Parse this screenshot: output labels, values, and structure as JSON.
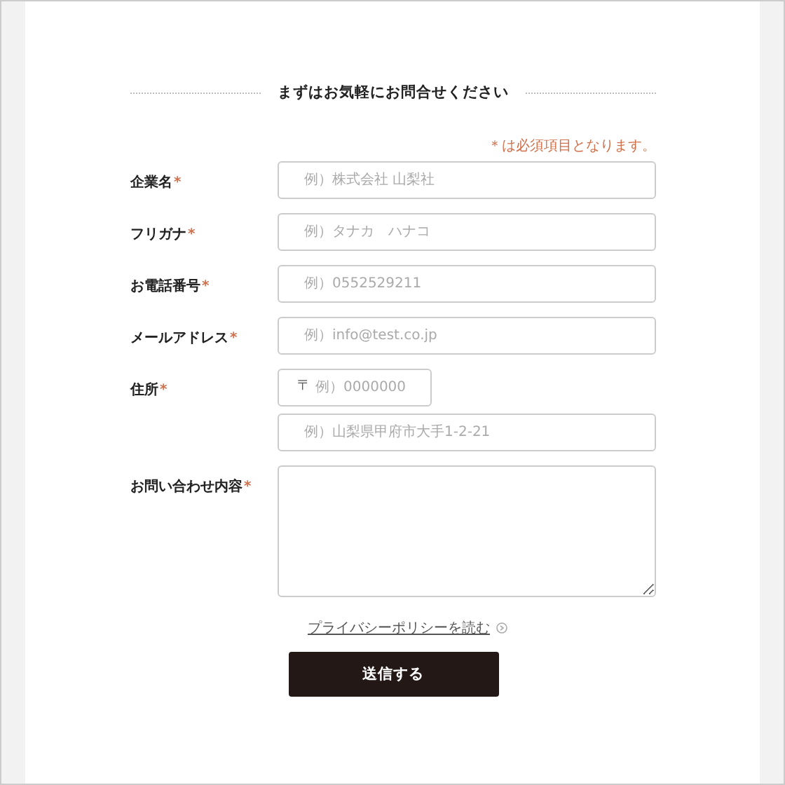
{
  "heading": "まずはお気軽にお問合せください",
  "required_note": "＊は必須項目となります。",
  "fields": [
    {
      "label": "企業名",
      "mark": "*",
      "kind": "text",
      "inputs": [
        {
          "placeholder": "例）株式会社 山梨社"
        }
      ]
    },
    {
      "label": "フリガナ",
      "mark": "*",
      "kind": "text",
      "inputs": [
        {
          "placeholder": "例）タナカ　ハナコ"
        }
      ]
    },
    {
      "label": "お電話番号",
      "mark": "*",
      "kind": "text",
      "inputs": [
        {
          "placeholder": "例）0552529211"
        }
      ]
    },
    {
      "label": "メールアドレス",
      "mark": "*",
      "kind": "text",
      "inputs": [
        {
          "placeholder": "例）info@test.co.jp"
        }
      ]
    },
    {
      "label": "住所",
      "mark": "*",
      "kind": "address",
      "inputs": [
        {
          "prefix": "〒",
          "placeholder": "例）0000000"
        },
        {
          "placeholder": "例）山梨県甲府市大手1-2-21"
        }
      ]
    },
    {
      "label": "お問い合わせ内容",
      "mark": "*",
      "kind": "textarea"
    }
  ],
  "privacy_link": "プライバシーポリシーを読む",
  "submit": "送信する"
}
